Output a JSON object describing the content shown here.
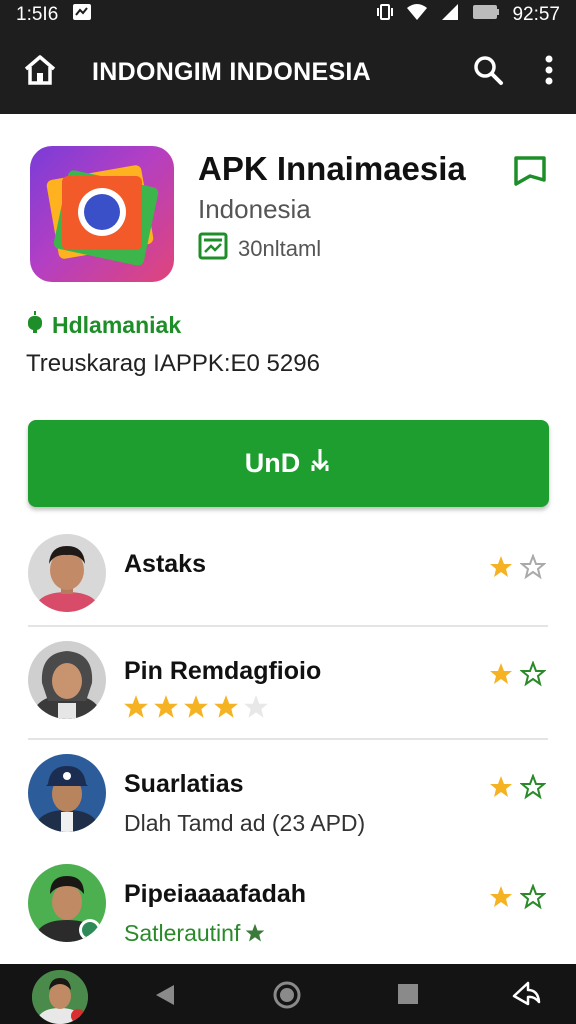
{
  "status_bar": {
    "time_left": "1:5I6",
    "time_right": "92:57"
  },
  "app_bar": {
    "title": "INDONGIM INDONESIA"
  },
  "app": {
    "title": "APK Innaimaesia",
    "subtitle": "Indonesia",
    "meta": "30nltaml",
    "developer": "Hdlamaniak",
    "version": "Treuskarag IAPPK:E0 5296"
  },
  "install_button": {
    "label": "UnD"
  },
  "reviews": [
    {
      "name": "Astaks",
      "sub": "",
      "rating_filled": 1,
      "rating_total": 2
    },
    {
      "name": "Pin Remdagfioio",
      "sub": "",
      "inline_stars_filled": 4,
      "inline_stars_total": 5,
      "rating_filled": 1,
      "rating_total": 2
    },
    {
      "name": "Suarlatias",
      "sub": "Dlah Tamd ad (23 APD)",
      "rating_filled": 1,
      "rating_total": 2
    },
    {
      "name": "Pipeiaaaafadah",
      "sub": "Satlerautinf",
      "rating_filled": 1,
      "rating_total": 2
    }
  ],
  "colors": {
    "bar_bg": "#1e1e1e",
    "accent_green": "#1e9e2f",
    "star_gold": "#f5b324",
    "star_outline_green": "#2a8a2a"
  },
  "icons": [
    "home-icon",
    "search-icon",
    "more-vert-icon",
    "bookmark-icon",
    "app-meta-icon",
    "android-icon",
    "download-icon",
    "star-icon",
    "back-icon",
    "home-circle-icon",
    "recents-icon",
    "share-icon"
  ]
}
